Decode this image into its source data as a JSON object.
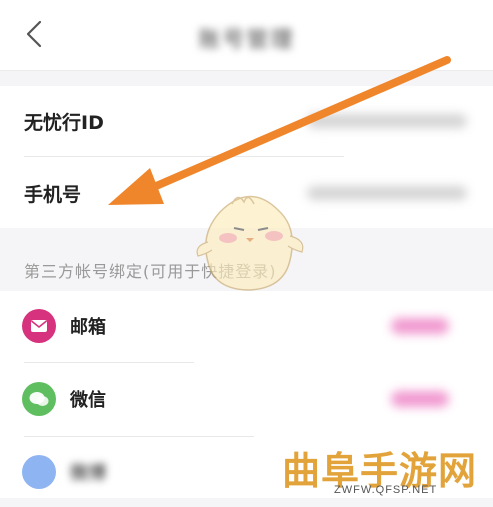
{
  "header": {
    "title": "账号管理"
  },
  "account": {
    "rows": [
      {
        "label": "无忧行ID"
      },
      {
        "label": "手机号"
      }
    ]
  },
  "third_party": {
    "title": "第三方帐号绑定(可用于快捷登录)",
    "items": [
      {
        "label": "邮箱",
        "icon": "mail-icon",
        "color": "#d6327d"
      },
      {
        "label": "微信",
        "icon": "wechat-icon",
        "color": "#5fbf60"
      },
      {
        "label": "微博",
        "icon": "weibo-icon",
        "color": "#8eb4f2"
      }
    ]
  },
  "annotation": {
    "arrow_color": "#f0862c"
  },
  "watermark": {
    "text": "曲阜手游网",
    "url": "ZWFW.QFSP.NET"
  }
}
